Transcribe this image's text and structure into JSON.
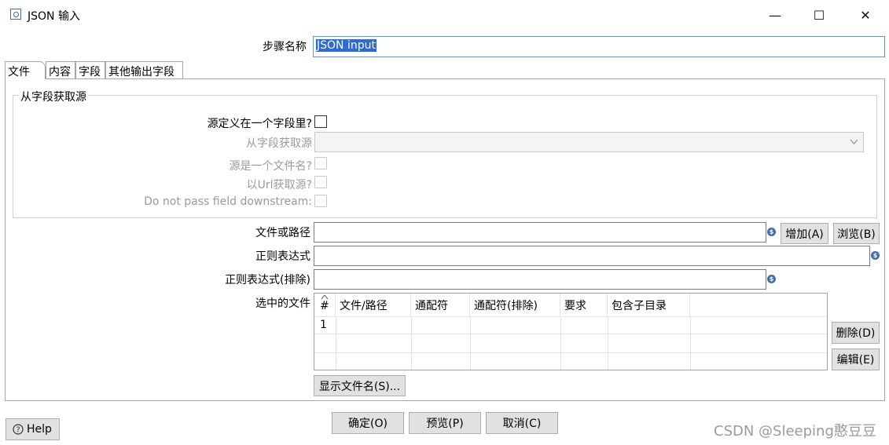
{
  "window": {
    "title": "JSON 输入",
    "minimize": "—",
    "maximize": "☐",
    "close": "✕"
  },
  "step": {
    "label": "步骤名称",
    "value": "JSON input"
  },
  "tabs": [
    {
      "label": "文件"
    },
    {
      "label": "内容"
    },
    {
      "label": "字段"
    },
    {
      "label": "其他输出字段"
    }
  ],
  "source_group": {
    "title": "从字段获取源",
    "source_in_field_label": "源定义在一个字段里?",
    "source_in_field_checked": false,
    "get_source_from_field_label": "从字段获取源",
    "source_is_filename_label": "源是一个文件名?",
    "read_source_as_url_label": "以Url获取源?",
    "do_not_pass_label": "Do not pass field downstream:"
  },
  "file": {
    "path_label": "文件或路径",
    "path_value": "",
    "add_button": "增加(A)",
    "browse_button": "浏览(B)",
    "regex_label": "正则表达式",
    "regex_value": "",
    "exclude_regex_label": "正则表达式(排除)",
    "exclude_regex_value": "",
    "selected_label": "选中的文件",
    "delete_button": "删除(D)",
    "edit_button": "编辑(E)",
    "show_filenames_button": "显示文件名(S)..."
  },
  "table": {
    "columns": [
      "#",
      "文件/路径",
      "通配符",
      "通配符(排除)",
      "要求",
      "包含子目录"
    ],
    "rows": [
      {
        "num": "1",
        "path": "",
        "wildcard": "",
        "exclude": "",
        "required": "",
        "subdirs": ""
      }
    ]
  },
  "footer": {
    "help": "Help",
    "ok": "确定(O)",
    "preview": "预览(P)",
    "cancel": "取消(C)"
  },
  "watermark": "CSDN @Sleeping憨豆豆",
  "colors": {
    "selection": "#2e6ad4",
    "focus_border": "#5a9ad6",
    "variable_icon": "#3d6fa8"
  }
}
